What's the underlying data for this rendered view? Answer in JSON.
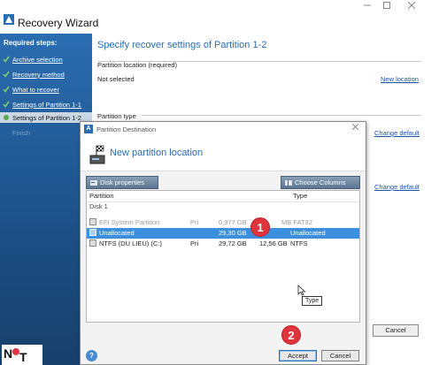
{
  "window": {
    "title": "Recovery Wizard",
    "min_icon": "minimize-icon",
    "max_icon": "maximize-icon",
    "close_icon": "close-icon"
  },
  "sidebar": {
    "heading": "Required steps:",
    "items": [
      {
        "label": "Archive selection",
        "done": true
      },
      {
        "label": "Recovery method",
        "done": true
      },
      {
        "label": "What to recover",
        "done": true
      },
      {
        "label": "Settings of Partition 1-1",
        "done": true
      },
      {
        "label": "Settings of Partition 1-2",
        "current": true
      },
      {
        "label": "Finish",
        "dim": true
      }
    ],
    "help": "?"
  },
  "main": {
    "heading": "Specify recover settings of Partition 1-2",
    "partition_location_label": "Partition location (required)",
    "partition_location_value": "Not selected",
    "new_location_link": "New location",
    "partition_type_label": "Partition type",
    "change_default_1": "Change default",
    "change_default_2": "Change default",
    "cancel_label": "Cancel"
  },
  "dialog": {
    "title": "Partition Destination",
    "icon_letter": "A",
    "heading": "New partition location",
    "disk_properties": "Disk properties",
    "choose_columns": "Choose Columns",
    "col_partition": "Partition",
    "col_type": "Type",
    "disk_label": "Disk 1",
    "rows": [
      {
        "name": "EFI System Partition",
        "flag": "Pri",
        "capacity": "0,977 GB",
        "free": "",
        "type": "MB FAT32",
        "state": "gray"
      },
      {
        "name": "Unallocated",
        "flag": "",
        "capacity": "29,30 GB",
        "free": "",
        "type": "Unallocated",
        "state": "selected"
      },
      {
        "name": "NTFS (DU LIEU) (C:)",
        "flag": "Pri",
        "capacity": "29,72 GB",
        "free": "12,56 GB",
        "type": "NTFS",
        "state": "normal"
      }
    ],
    "tooltip": "Type",
    "accept_label": "Accept",
    "cancel_label": "Cancel",
    "help": "?"
  },
  "annotations": {
    "badge_1": "1",
    "badge_2": "2"
  },
  "colors": {
    "accent": "#2a6db1",
    "selection": "#3c8fdc",
    "badge": "#e0343c"
  }
}
